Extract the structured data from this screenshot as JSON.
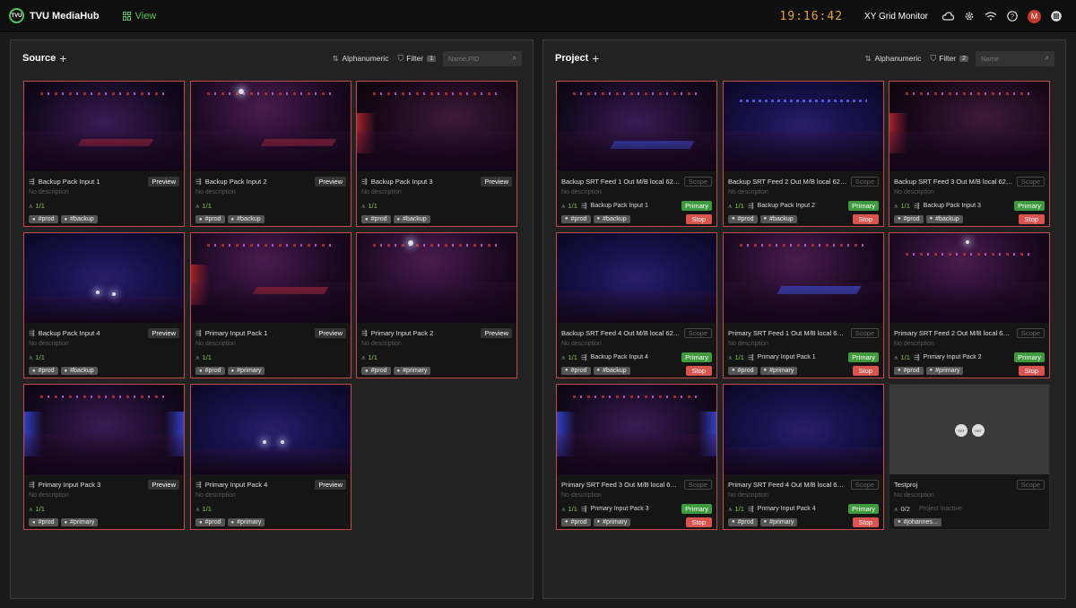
{
  "app": {
    "title": "TVU MediaHub",
    "logo_text": "TVU",
    "view_label": "View"
  },
  "topbar": {
    "clock": "19:16:42",
    "layout_name": "XY Grid Monitor",
    "avatar_initial": "M"
  },
  "source": {
    "title": "Source",
    "sort_label": "Alphanumeric",
    "filter_label": "Filter",
    "filter_count": "1",
    "search_placeholder": "Name,PID",
    "cards": [
      {
        "name": "Backup Pack Input 1",
        "description": "No description",
        "count": "1/1",
        "preview": "Preview",
        "tags": [
          "#prod",
          "#backup"
        ]
      },
      {
        "name": "Backup Pack Input 2",
        "description": "No description",
        "count": "1/1",
        "preview": "Preview",
        "tags": [
          "#prod",
          "#backup"
        ]
      },
      {
        "name": "Backup Pack Input 3",
        "description": "No description",
        "count": "1/1",
        "preview": "Preview",
        "tags": [
          "#prod",
          "#backup"
        ]
      },
      {
        "name": "Backup Pack Input 4",
        "description": "No description",
        "count": "1/1",
        "preview": "Preview",
        "tags": [
          "#prod",
          "#backup"
        ]
      },
      {
        "name": "Primary Input Pack 1",
        "description": "No description",
        "count": "1/1",
        "preview": "Preview",
        "tags": [
          "#prod",
          "#primary"
        ]
      },
      {
        "name": "Primary Input Pack 2",
        "description": "No description",
        "count": "1/1",
        "preview": "Preview",
        "tags": [
          "#prod",
          "#primary"
        ]
      },
      {
        "name": "Primary Input Pack 3",
        "description": "No description",
        "count": "1/1",
        "preview": "Preview",
        "tags": [
          "#prod",
          "#primary"
        ]
      },
      {
        "name": "Primary Input Pack 4",
        "description": "No description",
        "count": "1/1",
        "preview": "Preview",
        "tags": [
          "#prod",
          "#primary"
        ]
      }
    ]
  },
  "project": {
    "title": "Project",
    "sort_label": "Alphanumeric",
    "filter_label": "Filter",
    "filter_count": "2",
    "search_placeholder": "Name",
    "cards": [
      {
        "name": "Backup SRT Feed 1 Out M/B local 62101 t...",
        "description": "No description",
        "count": "1/1",
        "source": "Backup Pack Input 1",
        "scope": "Scope",
        "primary": "Primary",
        "stop": "Stop",
        "tags": [
          "#prod",
          "#backup"
        ]
      },
      {
        "name": "Backup SRT Feed 2 Out M/B local 62102 ...",
        "description": "No description",
        "count": "1/1",
        "source": "Backup Pack Input 2",
        "scope": "Scope",
        "primary": "Primary",
        "stop": "Stop",
        "tags": [
          "#prod",
          "#backup"
        ]
      },
      {
        "name": "Backup SRT Feed 3 Out M/B local 62103 ...",
        "description": "No description",
        "count": "1/1",
        "source": "Backup Pack Input 3",
        "scope": "Scope",
        "primary": "Primary",
        "stop": "Stop",
        "tags": [
          "#prod",
          "#backup"
        ]
      },
      {
        "name": "Backup SRT Feed 4 Out M/B local 62104 ...",
        "description": "No description",
        "count": "1/1",
        "source": "Backup Pack Input 4",
        "scope": "Scope",
        "primary": "Primary",
        "stop": "Stop",
        "tags": [
          "#prod",
          "#backup"
        ]
      },
      {
        "name": "Primary SRT Feed 1 Out M/B local 62101 t...",
        "description": "No description",
        "count": "1/1",
        "source": "Primary Input Pack 1",
        "scope": "Scope",
        "primary": "Primary",
        "stop": "Stop",
        "tags": [
          "#prod",
          "#primary"
        ]
      },
      {
        "name": "Primary SRT Feed 2 Out M/B local 62102 ...",
        "description": "No description",
        "count": "1/1",
        "source": "Primary Input Pack 2",
        "scope": "Scope",
        "primary": "Primary",
        "stop": "Stop",
        "tags": [
          "#prod",
          "#primary"
        ]
      },
      {
        "name": "Primary SRT Feed 3 Out M/B local 62103 ...",
        "description": "No description",
        "count": "1/1",
        "source": "Primary Input Pack 3",
        "scope": "Scope",
        "primary": "Primary",
        "stop": "Stop",
        "tags": [
          "#prod",
          "#primary"
        ]
      },
      {
        "name": "Primary SRT Feed 4 Out M/B local 62104 ...",
        "description": "No description",
        "count": "1/1",
        "source": "Primary Input Pack 4",
        "scope": "Scope",
        "primary": "Primary",
        "stop": "Stop",
        "tags": [
          "#prod",
          "#primary"
        ]
      }
    ],
    "testproj": {
      "name": "Testproj",
      "description": "No description",
      "count": "0/2",
      "status": "Project Inactive",
      "scope": "Scope",
      "tags": [
        "#johannes..."
      ],
      "dot_label": "SRT"
    }
  },
  "colors": {
    "accent": "#56c25a",
    "card_border": "#c24a4a",
    "primary": "#3e9a3c",
    "stop": "#d9544f",
    "clock": "#e2a23a"
  }
}
